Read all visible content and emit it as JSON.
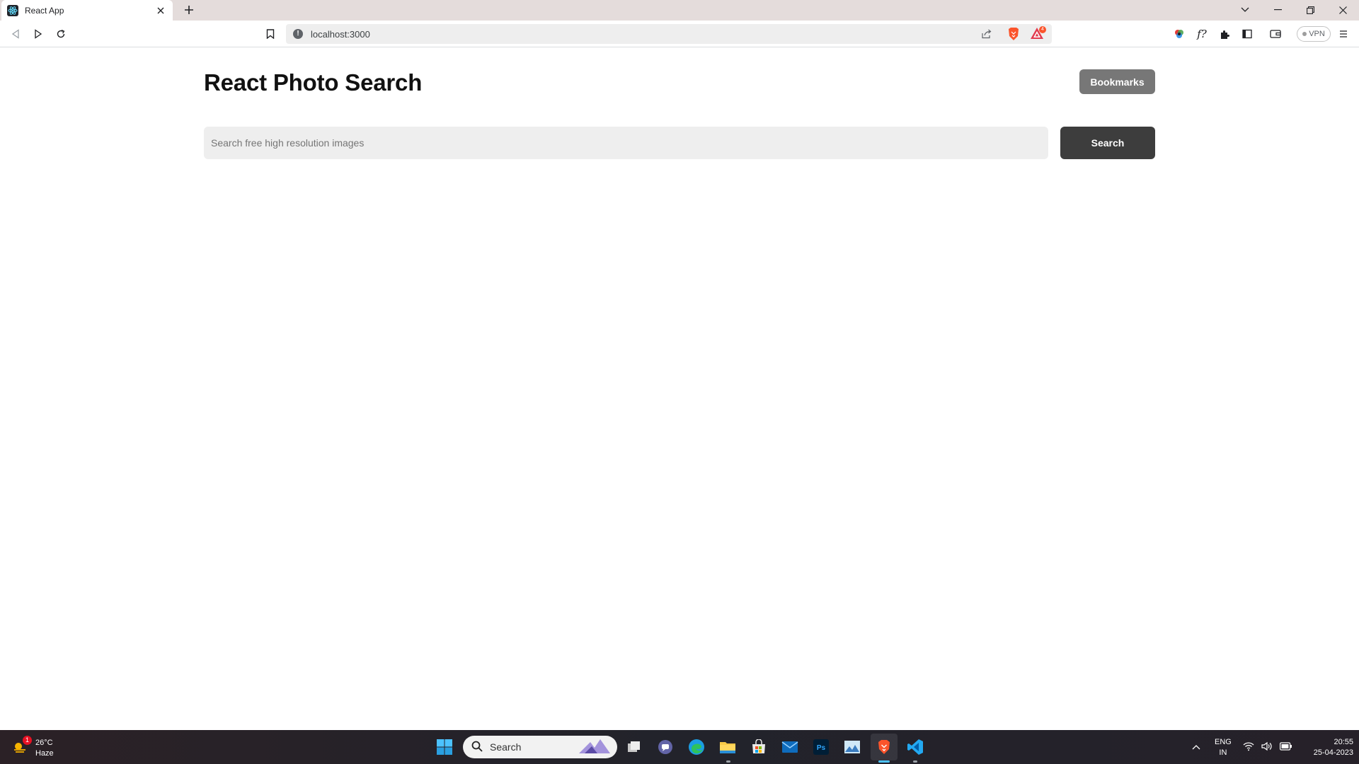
{
  "browser": {
    "tab": {
      "title": "React App",
      "favicon": "react-icon",
      "close_icon": "close-icon"
    },
    "new_tab_icon": "plus-icon",
    "window_controls": [
      "chevron-down-icon",
      "minimize-icon",
      "restore-icon",
      "close-icon"
    ],
    "address_bar": {
      "url": "localhost:3000",
      "info_icon": "info-icon",
      "share_icon": "share-icon"
    },
    "vpn_label": "VPN"
  },
  "app": {
    "title": "React Photo Search",
    "bookmarks_label": "Bookmarks",
    "search": {
      "placeholder": "Search free high resolution images",
      "value": "",
      "button_label": "Search"
    }
  },
  "taskbar": {
    "weather": {
      "temp": "26°C",
      "condition": "Haze",
      "badge": "1"
    },
    "search_label": "Search",
    "language": {
      "line1": "ENG",
      "line2": "IN"
    },
    "clock": {
      "time": "20:55",
      "date": "25-04-2023"
    }
  },
  "colors": {
    "accent_dark": "#3d3d3d",
    "bookmarks_bg": "#777777",
    "search_bg": "#eeeeee",
    "tabstrip_bg": "#e4dcdb",
    "brave_orange": "#fb542b"
  }
}
